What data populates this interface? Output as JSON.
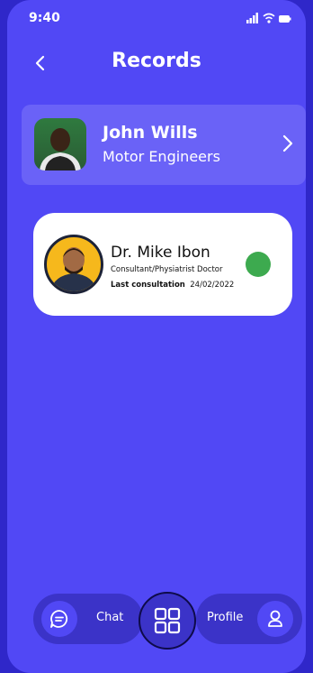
{
  "status_bar": {
    "time": "9:40"
  },
  "header": {
    "title": "Records"
  },
  "user": {
    "name": "John Wills",
    "role": "Motor Engineers"
  },
  "doctor": {
    "name": "Dr. Mike Ibon",
    "specialty": "Consultant/Physiatrist Doctor",
    "last_consultation_label": "Last consultation",
    "last_consultation_date": "24/02/2022",
    "status_color": "#3daa4f"
  },
  "bottom_nav": {
    "chat_label": "Chat",
    "profile_label": "Profile"
  },
  "colors": {
    "background": "#5148f5",
    "card_highlight": "#6a62f7",
    "nav_pill": "#3b33c8",
    "online": "#3daa4f"
  }
}
